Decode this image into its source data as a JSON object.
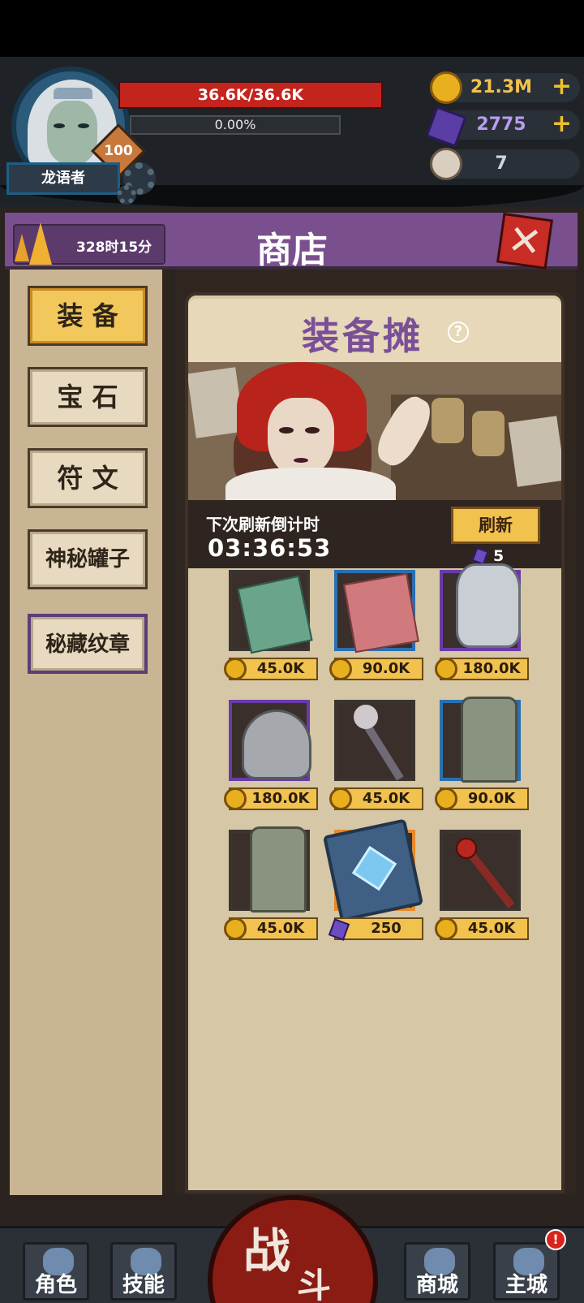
{
  "player": {
    "name": "龙语者",
    "level": "100",
    "hp": "36.6K/36.6K",
    "xp_percent": "0.00%",
    "xp_fraction": 0.0
  },
  "resources": {
    "gold": "21.3M",
    "gems": "2775",
    "horns": "7"
  },
  "shop": {
    "timer": "328时15分",
    "title": "商店",
    "close_label": "✕"
  },
  "categories": [
    {
      "label": "装 备",
      "active": true
    },
    {
      "label": "宝 石",
      "active": false
    },
    {
      "label": "符 文",
      "active": false
    },
    {
      "label": "神秘罐子",
      "active": false
    },
    {
      "label": "秘藏纹章",
      "active": false
    }
  ],
  "stall": {
    "title": "装备摊",
    "help": "?",
    "refresh_label": "下次刷新倒计时",
    "refresh_timer": "03:36:53",
    "refresh_button": "刷新",
    "refresh_cost": "5"
  },
  "items": [
    {
      "name": "green-scroll",
      "rarity": "common",
      "currency": "gold",
      "price": "45.0K"
    },
    {
      "name": "red-scroll",
      "rarity": "blue",
      "currency": "gold",
      "price": "90.0K"
    },
    {
      "name": "plate-armor",
      "rarity": "purple",
      "currency": "gold",
      "price": "180.0K"
    },
    {
      "name": "chainmail-hood",
      "rarity": "purple",
      "currency": "gold",
      "price": "180.0K"
    },
    {
      "name": "skull-staff",
      "rarity": "common",
      "currency": "gold",
      "price": "45.0K"
    },
    {
      "name": "cloth-pants-blue",
      "rarity": "blue",
      "currency": "gold",
      "price": "90.0K"
    },
    {
      "name": "cloth-pants",
      "rarity": "common",
      "currency": "gold",
      "price": "45.0K"
    },
    {
      "name": "rune-tome",
      "rarity": "orange",
      "currency": "gem",
      "price": "250"
    },
    {
      "name": "red-staff",
      "rarity": "common",
      "currency": "gold",
      "price": "45.0K"
    }
  ],
  "nav": {
    "character": "角色",
    "skills": "技能",
    "fight_1": "战",
    "fight_2": "斗",
    "mall": "商城",
    "city": "主城",
    "city_badge": "!"
  },
  "colors": {
    "hp_bar": "#c4241e",
    "shop_bar": "#7a4f8e",
    "active_category": "#f2c85c",
    "price_tag": "#f2c24e"
  }
}
